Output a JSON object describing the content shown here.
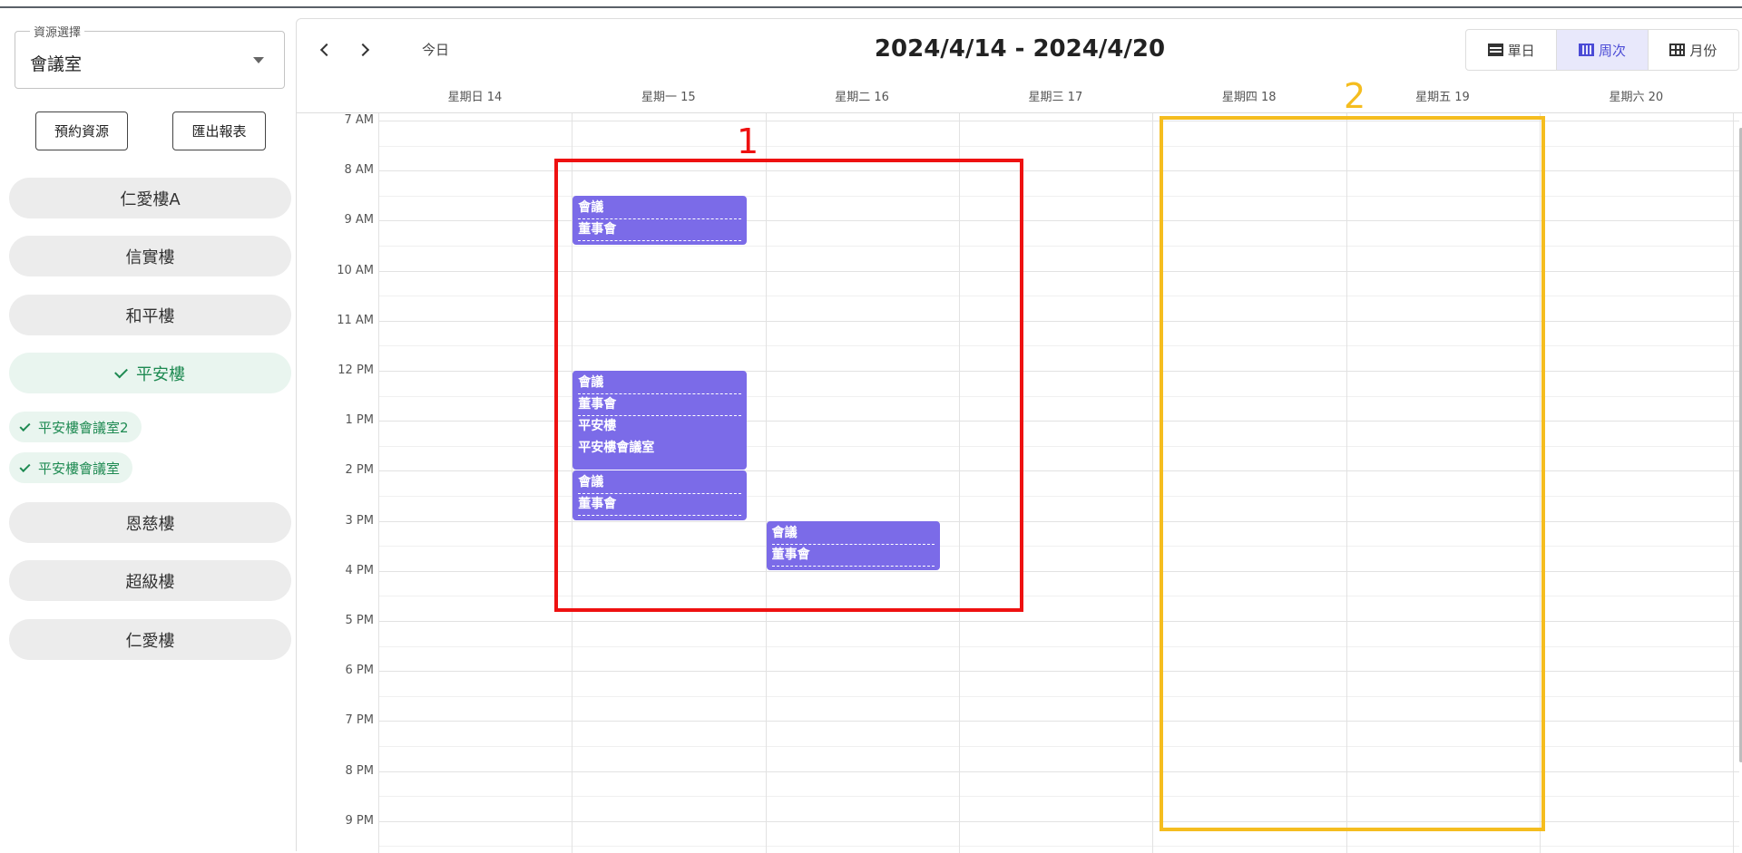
{
  "sidebar": {
    "resource_select": {
      "legend": "資源選擇",
      "value": "會議室"
    },
    "book_button": "預約資源",
    "export_button": "匯出報表",
    "buildings": [
      {
        "label": "仁愛樓A",
        "selected": false
      },
      {
        "label": "信實樓",
        "selected": false
      },
      {
        "label": "和平樓",
        "selected": false
      },
      {
        "label": "平安樓",
        "selected": true
      },
      {
        "label": "恩慈樓",
        "selected": false
      },
      {
        "label": "超級樓",
        "selected": false
      },
      {
        "label": "仁愛樓",
        "selected": false
      }
    ],
    "rooms": [
      {
        "label": "平安樓會議室2"
      },
      {
        "label": "平安樓會議室"
      }
    ]
  },
  "calendar": {
    "today_label": "今日",
    "range_title": "2024/4/14 - 2024/4/20",
    "views": [
      {
        "label": "單日",
        "icon": "day-view-icon",
        "active": false
      },
      {
        "label": "周次",
        "icon": "week-view-icon",
        "active": true
      },
      {
        "label": "月份",
        "icon": "month-view-icon",
        "active": false
      }
    ],
    "days": [
      "星期日 14",
      "星期一 15",
      "星期二 16",
      "星期三 17",
      "星期四 18",
      "星期五 19",
      "星期六 20"
    ],
    "time_slots": [
      "7 AM",
      "8 AM",
      "9 AM",
      "10 AM",
      "11 AM",
      "12 PM",
      "1 PM",
      "2 PM",
      "3 PM",
      "4 PM",
      "5 PM",
      "6 PM",
      "7 PM",
      "8 PM",
      "9 PM"
    ],
    "events": [
      {
        "day": 1,
        "start": 8.5,
        "end": 9.5,
        "lines": [
          "會議",
          "董事會"
        ]
      },
      {
        "day": 1,
        "start": 12,
        "end": 14,
        "lines": [
          "會議",
          "董事會",
          "平安樓",
          "平安樓會議室"
        ]
      },
      {
        "day": 1,
        "start": 14,
        "end": 15,
        "lines": [
          "會議",
          "董事會"
        ]
      },
      {
        "day": 2,
        "start": 15,
        "end": 16,
        "lines": [
          "會議",
          "董事會"
        ]
      }
    ]
  },
  "annotations": {
    "label_1": "1",
    "label_2": "2",
    "colors": {
      "box_1": "#ee1111",
      "box_2": "#f5bd1f"
    }
  },
  "colors": {
    "event": "#7b6be8",
    "selected_green": "#1e8a52",
    "active_view": "#4b4bd6"
  }
}
